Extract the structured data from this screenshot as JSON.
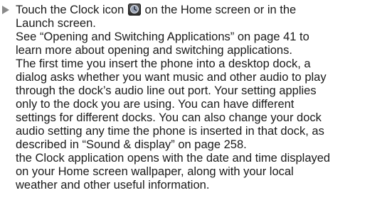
{
  "content": {
    "step_lead": "Touch the Clock icon",
    "step_after_icon": "on the Home screen or in the",
    "icon": "clock-icon",
    "lines": [
      "Launch screen.",
      "See “Opening and Switching Applications” on page 41 to",
      "learn more about opening and switching applications.",
      "The first time you insert the phone into a desktop dock, a",
      "dialog asks whether you want music and other audio to play",
      "through the dock’s audio line out port. Your setting applies",
      "only to the dock you are using. You can have different",
      "settings for different docks. You can also change your dock",
      "audio setting any time the phone is inserted in that dock, as",
      "described in “Sound & display” on page 258.",
      "the Clock application opens with the date and time displayed",
      "on your Home screen wallpaper, along with your local",
      "weather and other useful information."
    ]
  }
}
